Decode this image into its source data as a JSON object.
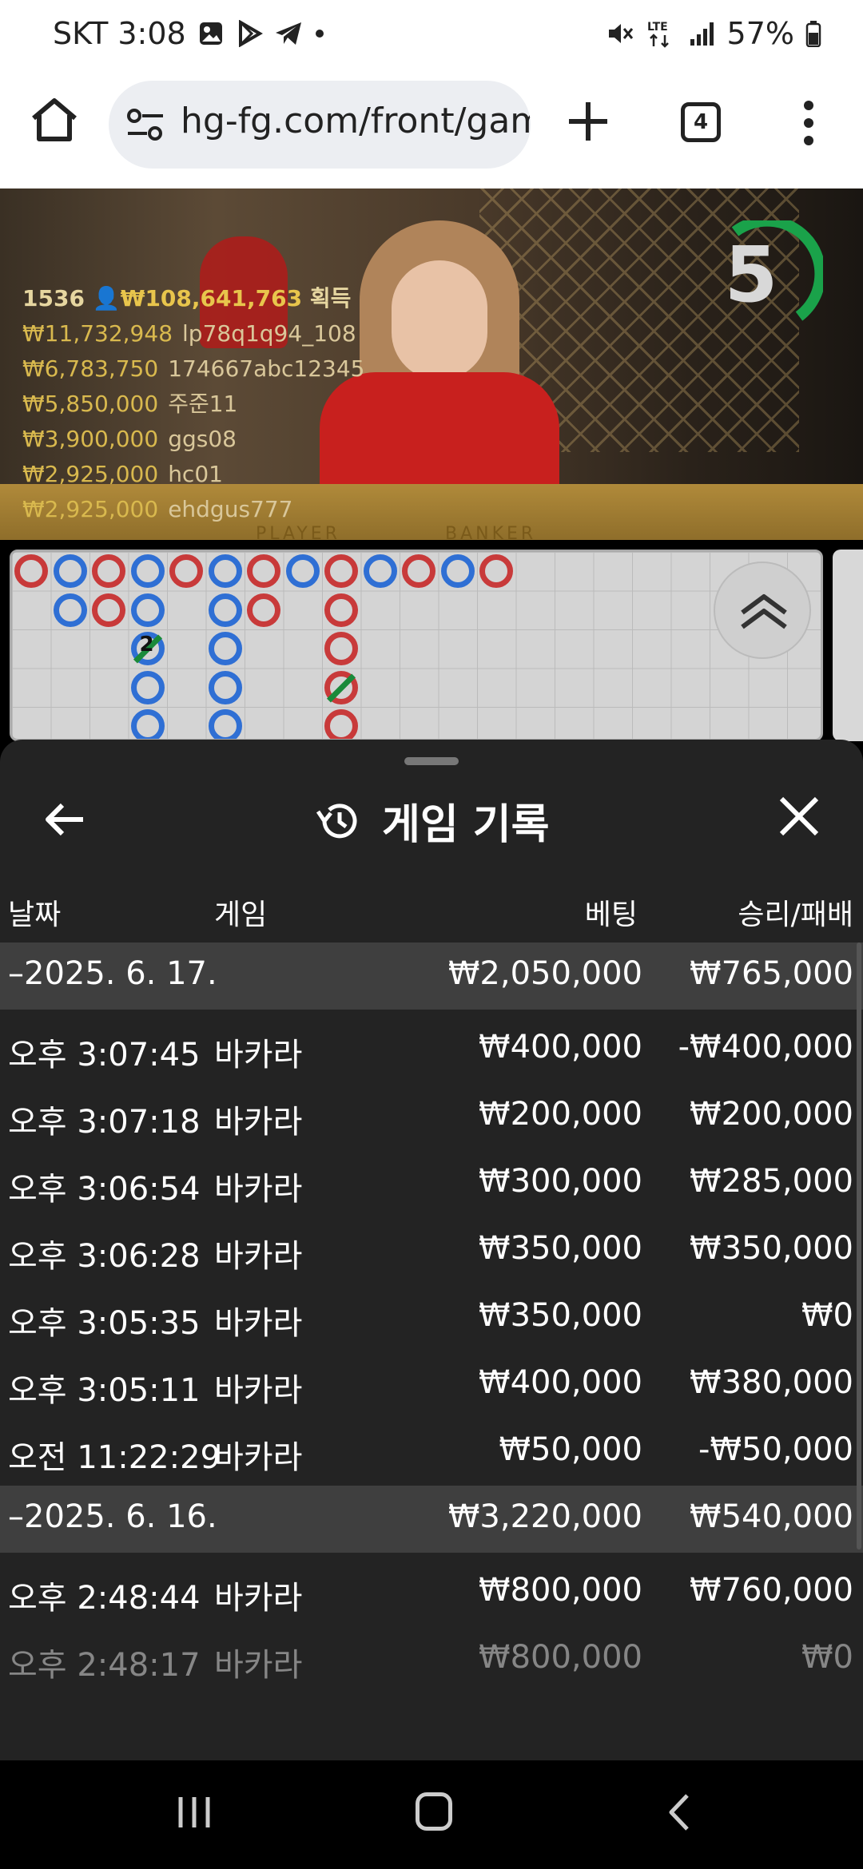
{
  "status_bar": {
    "carrier_time": "SKT 3:08",
    "notification_icons": [
      "image-icon",
      "play-store-icon",
      "telegram-icon",
      "dot-icon"
    ],
    "right_icons": [
      "mute-icon",
      "lte-icon",
      "signal-icon"
    ],
    "battery": "57%"
  },
  "browser": {
    "url": "hg-fg.com/front/game",
    "tab_count": "4"
  },
  "video": {
    "timer": "5",
    "table_labels": [
      "PLAYER",
      "BANKER"
    ],
    "top_line": {
      "id": "1536",
      "amount": "₩108,641,763",
      "suffix": "획득"
    },
    "leaders": [
      {
        "amount": "₩11,732,948",
        "name": "lp78q1q94_108"
      },
      {
        "amount": "₩6,783,750",
        "name": "174667abc12345"
      },
      {
        "amount": "₩5,850,000",
        "name": "주준11"
      },
      {
        "amount": "₩3,900,000",
        "name": "ggs08"
      },
      {
        "amount": "₩2,925,000",
        "name": "hc01"
      },
      {
        "amount": "₩2,925,000",
        "name": "ehdgus777"
      }
    ]
  },
  "road": {
    "tie_marker": "2",
    "colors": {
      "banker": "#c83a3a",
      "player": "#2f6fd4",
      "tie": "#1a8a3a"
    }
  },
  "sheet": {
    "title": "게임 기록",
    "columns": {
      "date": "날짜",
      "game": "게임",
      "bet": "베팅",
      "result": "승리/패배"
    },
    "groups": [
      {
        "date": "–2025. 6. 17.",
        "bet": "₩2,050,000",
        "result": "₩765,000",
        "rows": [
          {
            "time": "오후 3:07:45",
            "game": "바카라",
            "bet": "₩400,000",
            "result": "-₩400,000"
          },
          {
            "time": "오후 3:07:18",
            "game": "바카라",
            "bet": "₩200,000",
            "result": "₩200,000"
          },
          {
            "time": "오후 3:06:54",
            "game": "바카라",
            "bet": "₩300,000",
            "result": "₩285,000"
          },
          {
            "time": "오후 3:06:28",
            "game": "바카라",
            "bet": "₩350,000",
            "result": "₩350,000"
          },
          {
            "time": "오후 3:05:35",
            "game": "바카라",
            "bet": "₩350,000",
            "result": "₩0"
          },
          {
            "time": "오후 3:05:11",
            "game": "바카라",
            "bet": "₩400,000",
            "result": "₩380,000"
          },
          {
            "time": "오전 11:22:29",
            "game": "바카라",
            "bet": "₩50,000",
            "result": "-₩50,000"
          }
        ]
      },
      {
        "date": "–2025. 6. 16.",
        "bet": "₩3,220,000",
        "result": "₩540,000",
        "rows": [
          {
            "time": "오후 2:48:44",
            "game": "바카라",
            "bet": "₩800,000",
            "result": "₩760,000"
          },
          {
            "time": "오후 2:48:17",
            "game": "바카라",
            "bet": "₩800,000",
            "result": "₩0"
          }
        ]
      }
    ]
  },
  "navbar": {
    "icons": [
      "recents-icon",
      "home-icon",
      "back-icon"
    ]
  }
}
